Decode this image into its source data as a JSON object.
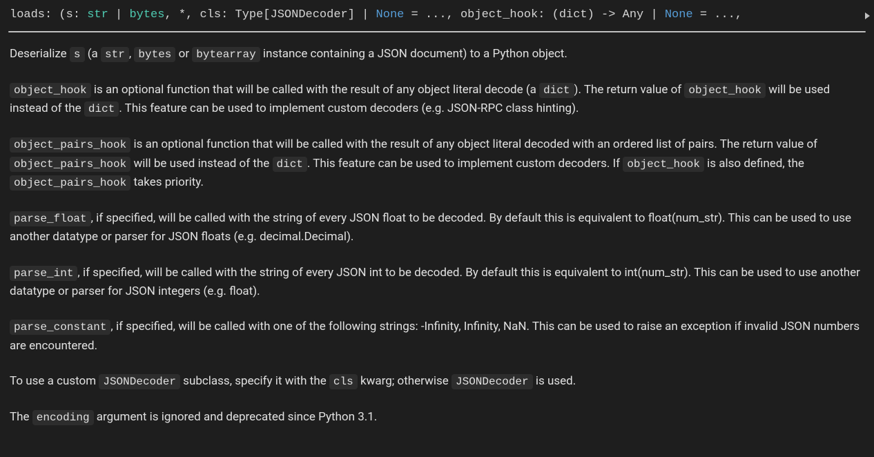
{
  "signature": {
    "func": "loads",
    "param1_name": "s",
    "type_str": "str",
    "type_bytes": "bytes",
    "star": "*",
    "param2_name": "cls",
    "param2_type": "Type[JSONDecoder]",
    "none": "None",
    "ellipsis": "...",
    "param3_name": "object_hook",
    "param3_type_in": "dict",
    "param3_type_out": "Any"
  },
  "para1": {
    "pre": "Deserialize ",
    "code_s": "s",
    "mid1": " (a ",
    "code_str": "str",
    "sep1": ", ",
    "code_bytes": "bytes",
    "sep2": " or ",
    "code_bytearray": "bytearray",
    "post": " instance containing a JSON document) to a Python object."
  },
  "para2": {
    "code_oh1": "object_hook",
    "t1": " is an optional function that will be called with the result of any object literal decode (a ",
    "code_dict1": "dict",
    "t2": "). The return value of ",
    "code_oh2": "object_hook",
    "t3": " will be used instead of the ",
    "code_dict2": "dict",
    "t4": ". This feature can be used to implement custom decoders (e.g. JSON-RPC class hinting)."
  },
  "para3": {
    "code_oph1": "object_pairs_hook",
    "t1": " is an optional function that will be called with the result of any object literal decoded with an ordered list of pairs. The return value of ",
    "code_oph2": "object_pairs_hook",
    "t2": " will be used instead of the ",
    "code_dict": "dict",
    "t3": ". This feature can be used to implement custom decoders. If ",
    "code_oh": "object_hook",
    "t4": " is also defined, the ",
    "code_oph3": "object_pairs_hook",
    "t5": " takes priority."
  },
  "para4": {
    "code_pf": "parse_float",
    "t1": ", if specified, will be called with the string of every JSON float to be decoded. By default this is equivalent to float(num_str). This can be used to use another datatype or parser for JSON floats (e.g. decimal.Decimal)."
  },
  "para5": {
    "code_pi": "parse_int",
    "t1": ", if specified, will be called with the string of every JSON int to be decoded. By default this is equivalent to int(num_str). This can be used to use another datatype or parser for JSON integers (e.g. float)."
  },
  "para6": {
    "code_pc": "parse_constant",
    "t1": ", if specified, will be called with one of the following strings: -Infinity, Infinity, NaN. This can be used to raise an exception if invalid JSON numbers are encountered."
  },
  "para7": {
    "t1": "To use a custom ",
    "code_jd1": "JSONDecoder",
    "t2": " subclass, specify it with the ",
    "code_cls": "cls",
    "t3": " kwarg; otherwise ",
    "code_jd2": "JSONDecoder",
    "t4": " is used."
  },
  "para8": {
    "t1": "The ",
    "code_enc": "encoding",
    "t2": " argument is ignored and deprecated since Python 3.1."
  }
}
